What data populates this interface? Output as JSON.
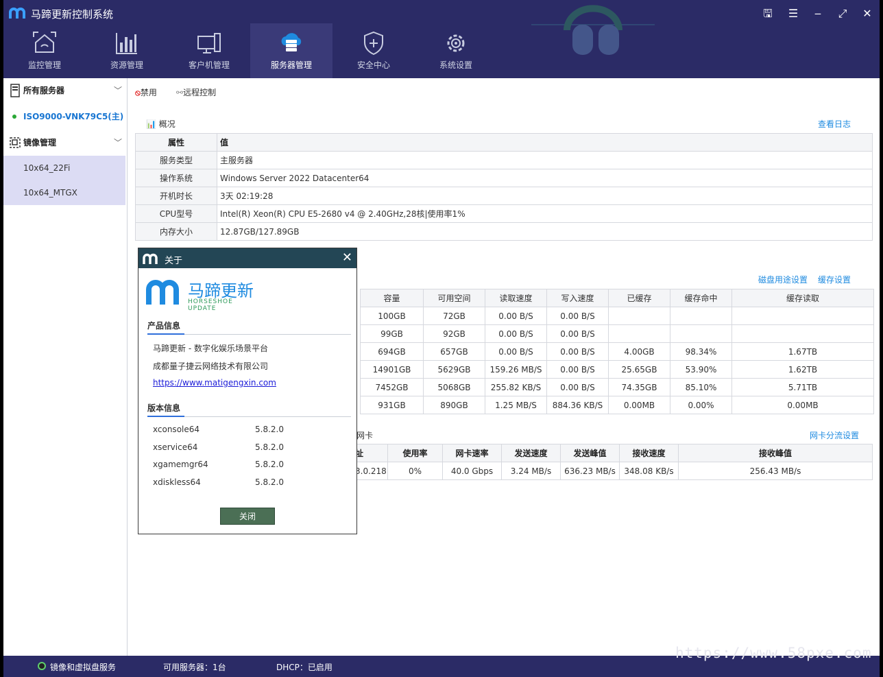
{
  "app": {
    "title": "马蹄更新控制系统"
  },
  "nav": [
    {
      "label": "监控管理",
      "icon": "home-icon"
    },
    {
      "label": "资源管理",
      "icon": "bar-chart-icon"
    },
    {
      "label": "客户机管理",
      "icon": "monitor-icon"
    },
    {
      "label": "服务器管理",
      "icon": "cloud-server-icon",
      "active": true
    },
    {
      "label": "安全中心",
      "icon": "shield-icon"
    },
    {
      "label": "系统设置",
      "icon": "gear-icon"
    }
  ],
  "sidebar": {
    "all_servers": "所有服务器",
    "server": "ISO9000-VNK79C5(主)",
    "image_mgmt": "镜像管理",
    "images": [
      "10x64_22Fi",
      "10x64_MTGX"
    ]
  },
  "toolbar": {
    "disable": "禁用",
    "remote": "远程控制"
  },
  "overview": {
    "title": "概况",
    "view_log": "查看日志",
    "header": [
      "属性",
      "值"
    ],
    "rows": [
      [
        "服务类型",
        "主服务器"
      ],
      [
        "操作系统",
        "Windows Server 2022 Datacenter64"
      ],
      [
        "开机时长",
        "3天 02:19:28"
      ],
      [
        "CPU型号",
        "Intel(R) Xeon(R) CPU E5-2680 v4 @ 2.40GHz,28核|使用率1%"
      ],
      [
        "内存大小",
        "12.87GB/127.89GB"
      ]
    ]
  },
  "disk": {
    "links": [
      "磁盘用途设置",
      "缓存设置"
    ],
    "header": [
      "容量",
      "可用空间",
      "读取速度",
      "写入速度",
      "已缓存",
      "缓存命中",
      "缓存读取"
    ],
    "rows": [
      [
        "100GB",
        "72GB",
        "0.00 B/S",
        "0.00 B/S",
        "",
        "",
        ""
      ],
      [
        "99GB",
        "92GB",
        "0.00 B/S",
        "0.00 B/S",
        "",
        "",
        ""
      ],
      [
        "694GB",
        "657GB",
        "0.00 B/S",
        "0.00 B/S",
        "4.00GB",
        "98.34%",
        "1.67TB"
      ],
      [
        "14901GB",
        "5629GB",
        "159.26 MB/S",
        "0.00 B/S",
        "25.65GB",
        "53.90%",
        "1.62TB"
      ],
      [
        "7452GB",
        "5068GB",
        "255.82 KB/S",
        "0.00 B/S",
        "74.35GB",
        "85.10%",
        "5.71TB"
      ],
      [
        "931GB",
        "890GB",
        "1.25 MB/S",
        "884.36 KB/S",
        "0.00MB",
        "0.00%",
        "0.00MB"
      ]
    ]
  },
  "nic": {
    "title": "网卡",
    "link": "网卡分流设置",
    "header": [
      "址",
      "使用率",
      "网卡速率",
      "发送速度",
      "发送峰值",
      "接收速度",
      "接收峰值"
    ],
    "rows": [
      [
        "3.0.218",
        "0%",
        "40.0 Gbps",
        "3.24 MB/s",
        "636.23 MB/s",
        "348.08 KB/s",
        "256.43 MB/s"
      ]
    ]
  },
  "statusbar": {
    "service": "镜像和虚拟盘服务",
    "servers": "可用服务器：1台",
    "dhcp": "DHCP：已启用"
  },
  "watermark": "https://www.58pxe.com",
  "dialog": {
    "title": "关于",
    "brand_cn": "马蹄更新",
    "brand_en": "HORSESHOE UPDATE",
    "product_title": "产品信息",
    "product_lines": [
      "马蹄更新 - 数字化娱乐场景平台",
      "成都量子捷云网络技术有限公司"
    ],
    "url": "https://www.matigengxin.com",
    "version_title": "版本信息",
    "versions": [
      {
        "name": "xconsole64",
        "ver": "5.8.2.0"
      },
      {
        "name": "xservice64",
        "ver": "5.8.2.0"
      },
      {
        "name": "xgamemgr64",
        "ver": "5.8.2.0"
      },
      {
        "name": "xdiskless64",
        "ver": "5.8.2.0"
      }
    ],
    "close_label": "关闭"
  },
  "colors": {
    "topbar": "#2b2b66",
    "accent": "#1f8be0",
    "dialog_bar": "#234655",
    "close_button": "#4b6f55"
  }
}
